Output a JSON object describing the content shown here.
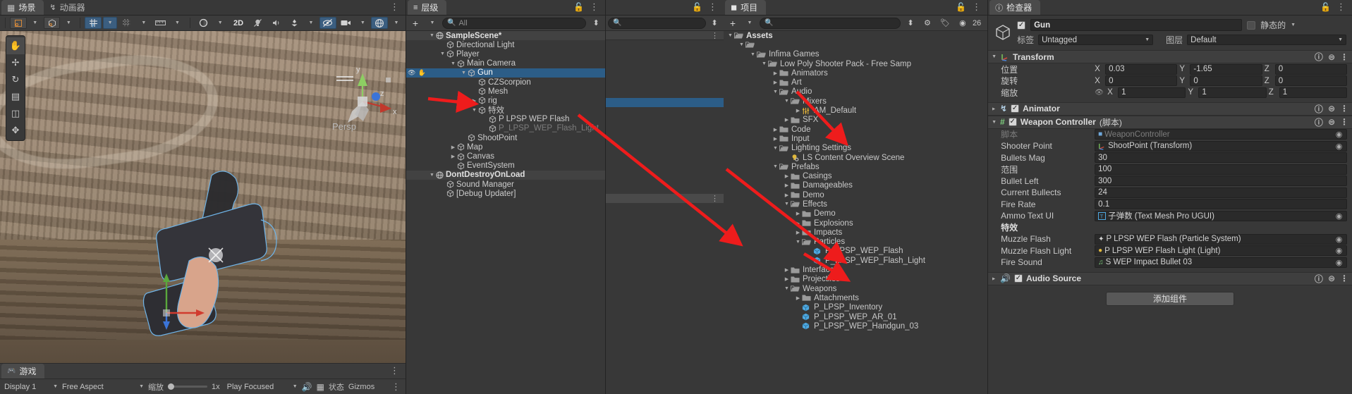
{
  "scene_panel": {
    "tabs": [
      {
        "label": "场景",
        "icon": "grid-icon",
        "active": true
      },
      {
        "label": "动画器",
        "icon": "animator-icon",
        "active": false
      }
    ],
    "toolbar": {
      "shading_label": "",
      "twod_label": "2D",
      "buttons": [
        "pivot-icon",
        "global-icon",
        "grid-snap-icon",
        "snap-increment-icon",
        "ruler-icon",
        "shading-icon",
        "2D",
        "lighting-icon",
        "audio-icon",
        "fx-icon",
        "hidden-icon",
        "camera-icon",
        "gizmos-icon"
      ]
    },
    "toolbox_tools": [
      "hand-tool",
      "move-tool",
      "rotate-tool",
      "scale-tool",
      "rect-tool",
      "transform-tool"
    ],
    "gizmo": {
      "x": "x",
      "y": "y",
      "z": "z",
      "persp_label": "Persp"
    },
    "game_tab": {
      "label": "游戏",
      "icon": "game-icon"
    },
    "status_bar": {
      "display": "Display 1",
      "aspect": "Free Aspect",
      "scale_label": "缩放",
      "scale_value": "1x",
      "play_mode": "Play Focused",
      "stats_label": "状态",
      "gizmos_label": "Gizmos"
    }
  },
  "hierarchy": {
    "tab_label": "层级",
    "create_label": "+",
    "search_placeholder": "All",
    "items": [
      {
        "label": "SampleScene*",
        "depth": 1,
        "arrow": "down",
        "icon": "scene-icon",
        "kind": "scene"
      },
      {
        "label": "Directional Light",
        "depth": 2,
        "arrow": "none",
        "icon": "gameobject-icon"
      },
      {
        "label": "Player",
        "depth": 2,
        "arrow": "down",
        "icon": "gameobject-icon"
      },
      {
        "label": "Main Camera",
        "depth": 3,
        "arrow": "down",
        "icon": "gameobject-icon"
      },
      {
        "label": "Gun",
        "depth": 4,
        "arrow": "down",
        "icon": "gameobject-icon",
        "selected": true,
        "vis": true
      },
      {
        "label": "CZScorpion",
        "depth": 5,
        "arrow": "none",
        "icon": "gameobject-icon"
      },
      {
        "label": "Mesh",
        "depth": 5,
        "arrow": "none",
        "icon": "gameobject-icon"
      },
      {
        "label": "rig",
        "depth": 5,
        "arrow": "right",
        "icon": "gameobject-icon"
      },
      {
        "label": "特效",
        "depth": 5,
        "arrow": "down",
        "icon": "gameobject-icon"
      },
      {
        "label": "P LPSP WEP Flash",
        "depth": 6,
        "arrow": "none",
        "icon": "gameobject-icon"
      },
      {
        "label": "P_LPSP_WEP_Flash_Light",
        "depth": 6,
        "arrow": "none",
        "icon": "gameobject-icon",
        "dim": true
      },
      {
        "label": "ShootPoint",
        "depth": 4,
        "arrow": "none",
        "icon": "gameobject-icon"
      },
      {
        "label": "Map",
        "depth": 3,
        "arrow": "right",
        "icon": "gameobject-icon"
      },
      {
        "label": "Canvas",
        "depth": 3,
        "arrow": "right",
        "icon": "gameobject-icon"
      },
      {
        "label": "EventSystem",
        "depth": 3,
        "arrow": "none",
        "icon": "gameobject-icon"
      },
      {
        "label": "DontDestroyOnLoad",
        "depth": 1,
        "arrow": "down",
        "icon": "scene-icon",
        "kind": "scene"
      },
      {
        "label": "Sound Manager",
        "depth": 2,
        "arrow": "none",
        "icon": "gameobject-icon"
      },
      {
        "label": "[Debug Updater]",
        "depth": 2,
        "arrow": "none",
        "icon": "gameobject-icon"
      }
    ]
  },
  "project": {
    "tab_label": "项目",
    "create_label": "+",
    "search_placeholder": "",
    "asset_count": "26",
    "items": [
      {
        "label": "Assets",
        "depth": 0,
        "arrow": "down",
        "icon": "folder-open",
        "bold": true
      },
      {
        "label": "",
        "depth": 1,
        "arrow": "down",
        "icon": "folder-open"
      },
      {
        "label": "Infima Games",
        "depth": 2,
        "arrow": "down",
        "icon": "folder-open"
      },
      {
        "label": "Low Poly Shooter Pack - Free Samp",
        "depth": 3,
        "arrow": "down",
        "icon": "folder-open"
      },
      {
        "label": "Animators",
        "depth": 4,
        "arrow": "right",
        "icon": "folder"
      },
      {
        "label": "Art",
        "depth": 4,
        "arrow": "right",
        "icon": "folder"
      },
      {
        "label": "Audio",
        "depth": 4,
        "arrow": "down",
        "icon": "folder-open"
      },
      {
        "label": "Mixers",
        "depth": 5,
        "arrow": "down",
        "icon": "folder-open"
      },
      {
        "label": "AM_Default",
        "depth": 6,
        "arrow": "right",
        "icon": "mixer-icon"
      },
      {
        "label": "SFX",
        "depth": 5,
        "arrow": "right",
        "icon": "folder"
      },
      {
        "label": "Code",
        "depth": 4,
        "arrow": "right",
        "icon": "folder"
      },
      {
        "label": "Input",
        "depth": 4,
        "arrow": "right",
        "icon": "folder"
      },
      {
        "label": "Lighting Settings",
        "depth": 4,
        "arrow": "down",
        "icon": "folder-open"
      },
      {
        "label": "LS Content Overview Scene",
        "depth": 5,
        "arrow": "none",
        "icon": "lightsettings-icon"
      },
      {
        "label": "Prefabs",
        "depth": 4,
        "arrow": "down",
        "icon": "folder-open"
      },
      {
        "label": "Casings",
        "depth": 5,
        "arrow": "right",
        "icon": "folder"
      },
      {
        "label": "Damageables",
        "depth": 5,
        "arrow": "right",
        "icon": "folder"
      },
      {
        "label": "Demo",
        "depth": 5,
        "arrow": "right",
        "icon": "folder"
      },
      {
        "label": "Effects",
        "depth": 5,
        "arrow": "down",
        "icon": "folder-open"
      },
      {
        "label": "Demo",
        "depth": 6,
        "arrow": "right",
        "icon": "folder"
      },
      {
        "label": "Explosions",
        "depth": 6,
        "arrow": "right",
        "icon": "folder"
      },
      {
        "label": "Impacts",
        "depth": 6,
        "arrow": "right",
        "icon": "folder"
      },
      {
        "label": "Particles",
        "depth": 6,
        "arrow": "down",
        "icon": "folder-open"
      },
      {
        "label": "P_LPSP_WEP_Flash",
        "depth": 7,
        "arrow": "none",
        "icon": "prefab-icon"
      },
      {
        "label": "P_LPSP_WEP_Flash_Light",
        "depth": 7,
        "arrow": "none",
        "icon": "prefab-icon"
      },
      {
        "label": "Interface",
        "depth": 5,
        "arrow": "right",
        "icon": "folder"
      },
      {
        "label": "Projectiles",
        "depth": 5,
        "arrow": "right",
        "icon": "folder"
      },
      {
        "label": "Weapons",
        "depth": 5,
        "arrow": "down",
        "icon": "folder-open"
      },
      {
        "label": "Attachments",
        "depth": 6,
        "arrow": "right",
        "icon": "folder"
      },
      {
        "label": "P_LPSP_Inventory",
        "depth": 6,
        "arrow": "none",
        "icon": "prefab-icon"
      },
      {
        "label": "P_LPSP_WEP_AR_01",
        "depth": 6,
        "arrow": "none",
        "icon": "prefab-icon"
      },
      {
        "label": "P_LPSP_WEP_Handgun_03",
        "depth": 6,
        "arrow": "none",
        "icon": "prefab-icon"
      }
    ]
  },
  "inspector": {
    "tab_label": "检查器",
    "object_name": "Gun",
    "object_enabled": true,
    "static_label": "静态的",
    "tag_label": "标签",
    "tag_value": "Untagged",
    "layer_label": "图层",
    "layer_value": "Default",
    "transform": {
      "title": "Transform",
      "position_label": "位置",
      "position": {
        "x": "0.03",
        "y": "-1.65",
        "z": "0"
      },
      "rotation_label": "旋转",
      "rotation": {
        "x": "0",
        "y": "0",
        "z": "0"
      },
      "scale_label": "缩放",
      "scale": {
        "x": "1",
        "y": "1",
        "z": "1"
      }
    },
    "animator": {
      "title": "Animator",
      "enabled": true
    },
    "weapon_controller": {
      "title": "Weapon Controller",
      "suffix": "(脚本)",
      "enabled": true,
      "fields": [
        {
          "label": "脚本",
          "value": "WeaponController",
          "type": "object",
          "icon": "script-icon",
          "dim": true
        },
        {
          "label": "Shooter Point",
          "value": "ShootPoint (Transform)",
          "type": "object",
          "icon": "transform-icon"
        },
        {
          "label": "Bullets Mag",
          "value": "30",
          "type": "number"
        },
        {
          "label": "范围",
          "value": "100",
          "type": "number"
        },
        {
          "label": "Bullet Left",
          "value": "300",
          "type": "number"
        },
        {
          "label": "Current Bullects",
          "value": "24",
          "type": "number"
        },
        {
          "label": "Fire Rate",
          "value": "0.1",
          "type": "number"
        },
        {
          "label": "Ammo Text UI",
          "value": "子弹数 (Text Mesh Pro UGUI)",
          "type": "object",
          "icon": "tmp-icon"
        }
      ],
      "section_label": "特效",
      "effect_fields": [
        {
          "label": "Muzzle Flash",
          "value": "P LPSP WEP Flash (Particle System)",
          "type": "object",
          "icon": "particle-icon"
        },
        {
          "label": "Muzzle Flash Light",
          "value": "P LPSP WEP Flash Light (Light)",
          "type": "object",
          "icon": "light-icon"
        },
        {
          "label": "Fire Sound",
          "value": "S WEP Impact Bullet 03",
          "type": "object",
          "icon": "audio-icon"
        }
      ]
    },
    "audio_source": {
      "title": "Audio Source",
      "enabled": true
    },
    "add_component_label": "添加组件"
  },
  "annotations": {
    "arrow_color": "#ee1c1c",
    "arrows": [
      "hierarchy-tezhiao-arrow",
      "project-particles-arrow",
      "inspector-shooter-point-arrow",
      "inspector-muzzle-arrow",
      "inspector-audio-arrow"
    ]
  }
}
